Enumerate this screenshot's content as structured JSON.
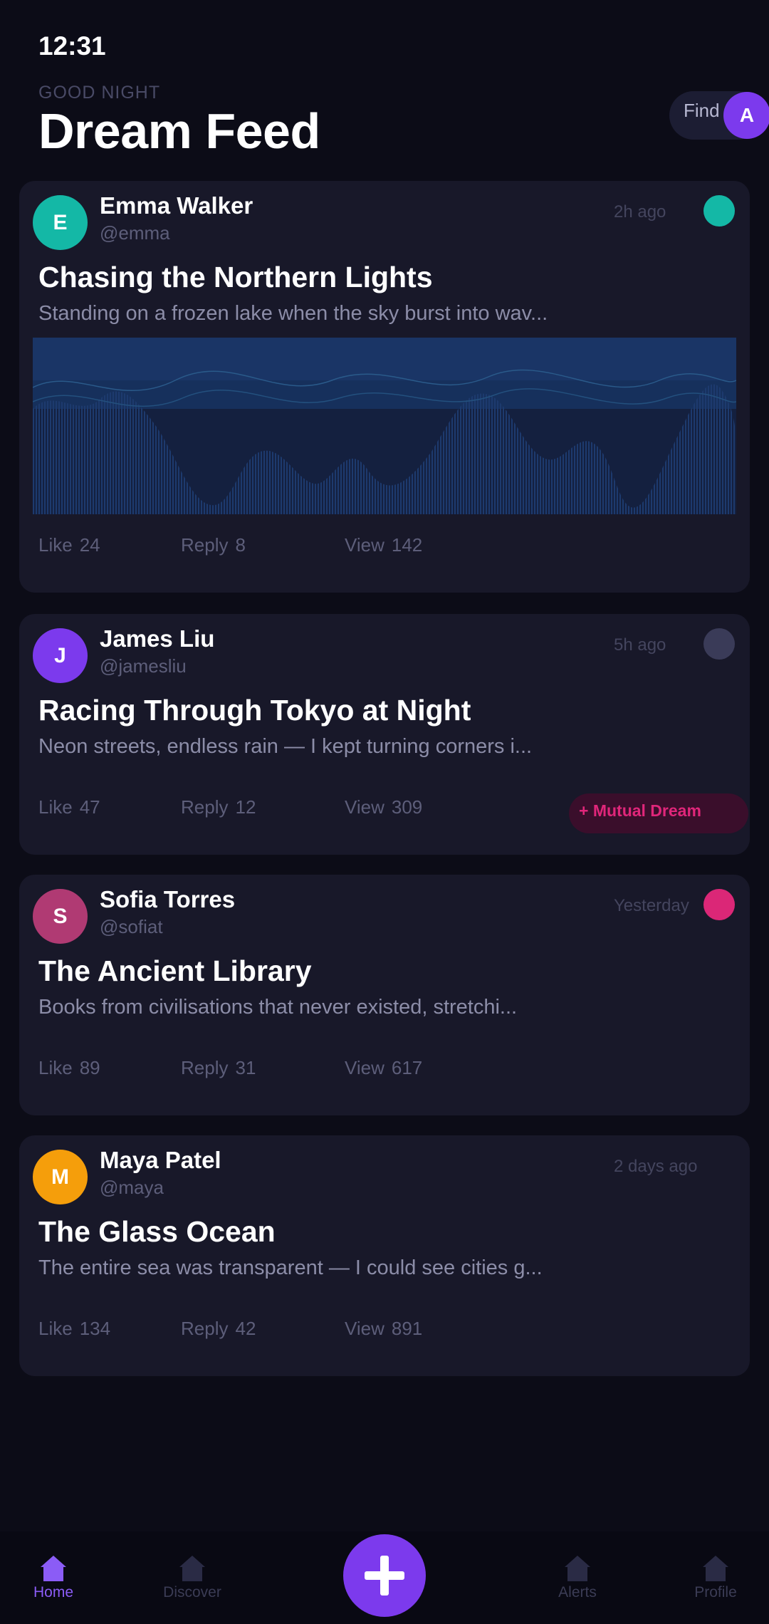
{
  "status": {
    "time": "12:31"
  },
  "header": {
    "greeting": "GOOD NIGHT",
    "title": "Dream Feed",
    "find_label": "Find",
    "account_initial": "A"
  },
  "posts": [
    {
      "author": "Emma Walker",
      "handle": "@emma",
      "initial": "E",
      "avatar_color": "#14b8a6",
      "time": "2h ago",
      "status_color": "#14b8a6",
      "title": "Chasing the Northern Lights",
      "excerpt": "Standing on a frozen lake when the sky burst into wav...",
      "like_label": "Like",
      "likes": "24",
      "reply_label": "Reply",
      "replies": "8",
      "view_label": "View",
      "views": "142",
      "has_waveform": true
    },
    {
      "author": "James Liu",
      "handle": "@jamesliu",
      "initial": "J",
      "avatar_color": "#7c3aed",
      "time": "5h ago",
      "status_color": "#3a3b58",
      "title": "Racing Through Tokyo at Night",
      "excerpt": "Neon streets, endless rain — I kept turning corners i...",
      "like_label": "Like",
      "likes": "47",
      "reply_label": "Reply",
      "replies": "12",
      "view_label": "View",
      "views": "309",
      "badge": "+ Mutual Dream"
    },
    {
      "author": "Sofia Torres",
      "handle": "@sofiat",
      "initial": "S",
      "avatar_color": "#b03a73",
      "time": "Yesterday",
      "status_color": "#db2777",
      "title": "The Ancient Library",
      "excerpt": "Books from civilisations that never existed, stretchi...",
      "like_label": "Like",
      "likes": "89",
      "reply_label": "Reply",
      "replies": "31",
      "view_label": "View",
      "views": "617"
    },
    {
      "author": "Maya Patel",
      "handle": "@maya",
      "initial": "M",
      "avatar_color": "#f59e0b",
      "time": "2 days ago",
      "title": "The Glass Ocean",
      "excerpt": "The entire sea was transparent — I could see cities g...",
      "like_label": "Like",
      "likes": "134",
      "reply_label": "Reply",
      "replies": "42",
      "view_label": "View",
      "views": "891"
    }
  ],
  "nav": {
    "items": [
      {
        "label": "Home",
        "icon": "home-icon",
        "active": true
      },
      {
        "label": "Discover",
        "icon": "discover-icon"
      },
      {
        "label": "Alerts",
        "icon": "alerts-icon"
      },
      {
        "label": "Profile",
        "icon": "profile-icon"
      }
    ],
    "fab_icon": "plus-icon"
  },
  "colors": {
    "background": "#0c0c17",
    "card": "#181829",
    "accent": "#7c3aed",
    "nav_active": "#8b5cf6",
    "waveform": "#1d3a6e"
  }
}
